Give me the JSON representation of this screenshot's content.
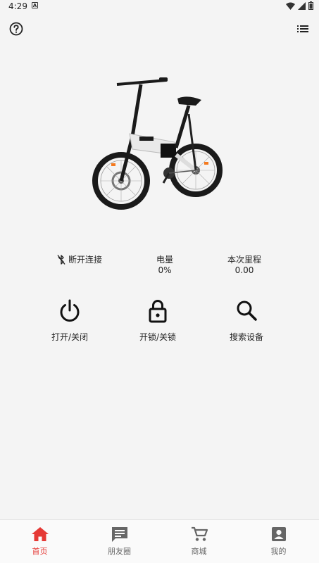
{
  "status_bar": {
    "time": "4:29",
    "notification_icon": "a-icon",
    "wifi_icon": "wifi-icon",
    "signal_icon": "signal-icon",
    "battery_icon": "battery-icon"
  },
  "app_bar": {
    "left_icon": "help-circle-icon",
    "right_icon": "list-menu-icon"
  },
  "device": {
    "image": "electric-bike-image",
    "connection_icon": "bluetooth-disabled-icon",
    "connection_status": "断开连接"
  },
  "stats": {
    "battery_label": "电量",
    "battery_value": "0%",
    "trip_label": "本次里程",
    "trip_value": "0.00"
  },
  "actions": [
    {
      "icon": "power-icon",
      "label": "打开/关闭"
    },
    {
      "icon": "lock-icon",
      "label": "开锁/关锁"
    },
    {
      "icon": "search-icon",
      "label": "搜索设备"
    }
  ],
  "bottom_nav": [
    {
      "icon": "home-icon",
      "label": "首页",
      "active": true
    },
    {
      "icon": "chat-icon",
      "label": "朋友圈",
      "active": false
    },
    {
      "icon": "cart-icon",
      "label": "商城",
      "active": false
    },
    {
      "icon": "account-icon",
      "label": "我的",
      "active": false
    }
  ],
  "colors": {
    "background": "#f4f4f4",
    "active": "#e53935",
    "inactive_icon": "#666666",
    "text": "#222222"
  }
}
